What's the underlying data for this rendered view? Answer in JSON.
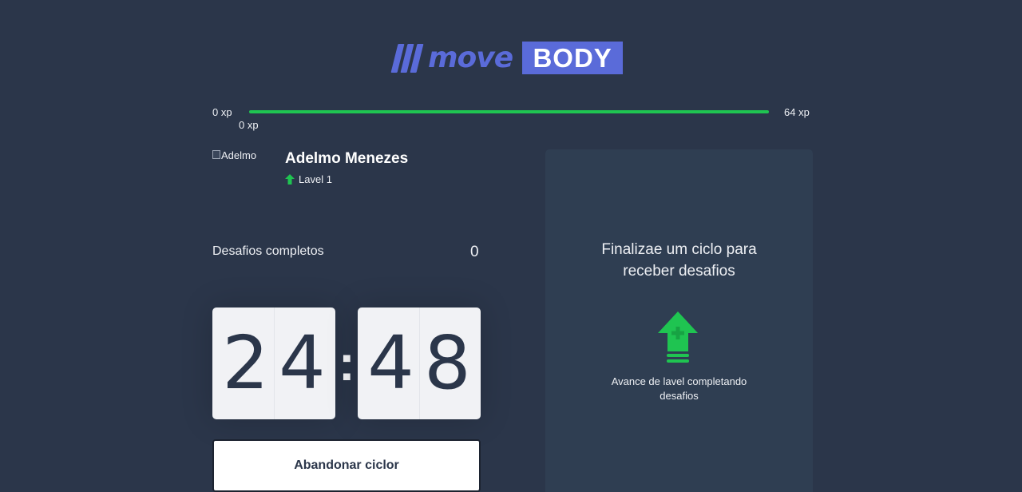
{
  "brand": {
    "move": "move",
    "body": "BODY",
    "accent_color": "#5a6bd9"
  },
  "xp": {
    "min_label": "0 xp",
    "max_label": "64 xp",
    "current_label": "0 xp",
    "progress_fraction": 1.0,
    "bar_color": "#1fc451"
  },
  "profile": {
    "avatar_alt": "Adelmo",
    "name": "Adelmo Menezes",
    "level_label": "Lavel 1"
  },
  "challenges": {
    "completed_label": "Desafios completos",
    "completed_value": "0"
  },
  "countdown": {
    "minute_tens": "2",
    "minute_ones": "4",
    "second_tens": "4",
    "second_ones": "8",
    "separator": ":"
  },
  "abandon_button": {
    "label": "Abandonar ciclor"
  },
  "challenge_panel": {
    "title": "Finalizae um ciclo para receber desafios",
    "hint": "Avance de lavel completando desafios",
    "icon": "level-up-icon",
    "icon_color": "#1fc451"
  }
}
